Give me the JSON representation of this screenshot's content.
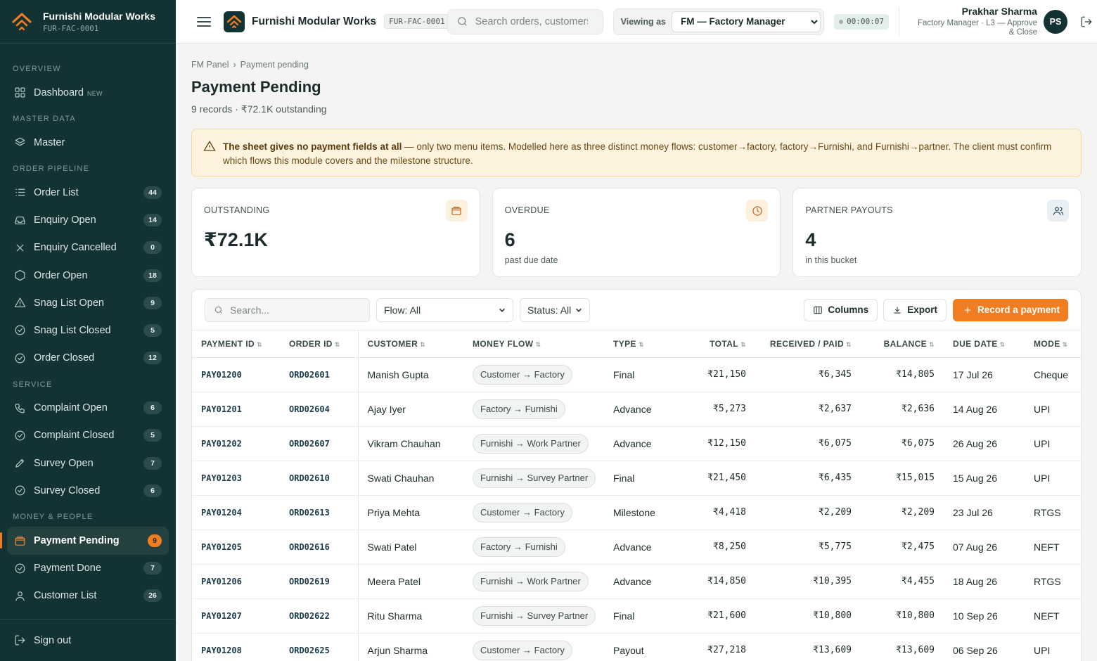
{
  "app": {
    "name": "Furnishi Modular Works",
    "code": "FUR-FAC-0001"
  },
  "sidebar": {
    "sections": [
      {
        "title": "OVERVIEW",
        "items": [
          {
            "label": "Dashboard",
            "tag": "NEW",
            "icon": "dashboard-icon"
          }
        ]
      },
      {
        "title": "MASTER DATA",
        "items": [
          {
            "label": "Master",
            "icon": "layers-icon"
          }
        ]
      },
      {
        "title": "ORDER PIPELINE",
        "items": [
          {
            "label": "Order List",
            "count": "44",
            "icon": "list-icon"
          },
          {
            "label": "Enquiry Open",
            "count": "14",
            "icon": "inbox-icon"
          },
          {
            "label": "Enquiry Cancelled",
            "count": "0",
            "icon": "x-icon"
          },
          {
            "label": "Order Open",
            "count": "18",
            "icon": "hexagon-icon"
          },
          {
            "label": "Snag List Open",
            "count": "9",
            "icon": "warning-icon"
          },
          {
            "label": "Snag List Closed",
            "count": "5",
            "icon": "check-circle-icon"
          },
          {
            "label": "Order Closed",
            "count": "12",
            "icon": "check-circle-icon"
          }
        ]
      },
      {
        "title": "SERVICE",
        "items": [
          {
            "label": "Complaint Open",
            "count": "6",
            "icon": "phone-icon"
          },
          {
            "label": "Complaint Closed",
            "count": "5",
            "icon": "check-circle-icon"
          },
          {
            "label": "Survey Open",
            "count": "7",
            "icon": "pencil-icon"
          },
          {
            "label": "Survey Closed",
            "count": "6",
            "icon": "check-circle-icon"
          }
        ]
      },
      {
        "title": "MONEY & PEOPLE",
        "items": [
          {
            "label": "Payment Pending",
            "count": "9",
            "icon": "wallet-icon",
            "active": true
          },
          {
            "label": "Payment Done",
            "count": "7",
            "icon": "check-circle-icon"
          },
          {
            "label": "Customer List",
            "count": "26",
            "icon": "user-icon"
          }
        ]
      }
    ],
    "signout_label": "Sign out"
  },
  "topbar": {
    "search_placeholder": "Search orders, customers",
    "viewing_label": "Viewing as",
    "viewing_selected": "FM — Factory Manager",
    "timer": "00:00:07",
    "user_name": "Prakhar Sharma",
    "user_role": "Factory Manager · L3 — Approve & Close",
    "avatar_initials": "PS"
  },
  "breadcrumb": {
    "root": "FM Panel",
    "current": "Payment pending"
  },
  "page": {
    "title": "Payment Pending",
    "subtitle": "9 records · ₹72.1K outstanding"
  },
  "alert": {
    "bold": "The sheet gives no payment fields at all",
    "text": " — only two menu items. Modelled here as three distinct money flows: customer→factory, factory→Furnishi, and Furnishi→partner. The client must confirm which flows this module covers and the milestone structure."
  },
  "stats": [
    {
      "label": "OUTSTANDING",
      "value": "₹72.1K",
      "sub": "",
      "icon": "wallet-icon",
      "icon_color": "#c2661a",
      "icon_bg": "#fdf0de"
    },
    {
      "label": "OVERDUE",
      "value": "6",
      "sub": "past due date",
      "icon": "clock-icon",
      "icon_color": "#c2661a",
      "icon_bg": "#fdf0de"
    },
    {
      "label": "PARTNER PAYOUTS",
      "value": "4",
      "sub": "in this bucket",
      "icon": "users-icon",
      "icon_color": "#2d4a57",
      "icon_bg": "#e9eff3"
    }
  ],
  "toolbar": {
    "search_placeholder": "Search...",
    "flow_filter": "Flow: All",
    "status_filter": "Status: All",
    "columns_label": "Columns",
    "export_label": "Export",
    "record_label": "Record a payment"
  },
  "table": {
    "columns": [
      "PAYMENT ID",
      "ORDER ID",
      "CUSTOMER",
      "MONEY FLOW",
      "TYPE",
      "TOTAL",
      "RECEIVED / PAID",
      "BALANCE",
      "DUE DATE",
      "MODE"
    ],
    "rows": [
      [
        "PAY01200",
        "ORD02601",
        "Manish Gupta",
        "Customer → Factory",
        "Final",
        "₹21,150",
        "₹6,345",
        "₹14,805",
        "17 Jul 26",
        "Cheque"
      ],
      [
        "PAY01201",
        "ORD02604",
        "Ajay Iyer",
        "Factory → Furnishi",
        "Advance",
        "₹5,273",
        "₹2,637",
        "₹2,636",
        "14 Aug 26",
        "UPI"
      ],
      [
        "PAY01202",
        "ORD02607",
        "Vikram Chauhan",
        "Furnishi → Work Partner",
        "Advance",
        "₹12,150",
        "₹6,075",
        "₹6,075",
        "26 Aug 26",
        "UPI"
      ],
      [
        "PAY01203",
        "ORD02610",
        "Swati Chauhan",
        "Furnishi → Survey Partner",
        "Final",
        "₹21,450",
        "₹6,435",
        "₹15,015",
        "15 Aug 26",
        "UPI"
      ],
      [
        "PAY01204",
        "ORD02613",
        "Priya Mehta",
        "Customer → Factory",
        "Milestone",
        "₹4,418",
        "₹2,209",
        "₹2,209",
        "23 Jul 26",
        "RTGS"
      ],
      [
        "PAY01205",
        "ORD02616",
        "Swati Patel",
        "Factory → Furnishi",
        "Advance",
        "₹8,250",
        "₹5,775",
        "₹2,475",
        "07 Aug 26",
        "NEFT"
      ],
      [
        "PAY01206",
        "ORD02619",
        "Meera Patel",
        "Furnishi → Work Partner",
        "Advance",
        "₹14,850",
        "₹10,395",
        "₹4,455",
        "18 Aug 26",
        "RTGS"
      ],
      [
        "PAY01207",
        "ORD02622",
        "Ritu Sharma",
        "Furnishi → Survey Partner",
        "Final",
        "₹21,600",
        "₹10,800",
        "₹10,800",
        "10 Sep 26",
        "NEFT"
      ],
      [
        "PAY01208",
        "ORD02625",
        "Arjun Sharma",
        "Customer → Factory",
        "Payout",
        "₹27,218",
        "₹13,609",
        "₹13,609",
        "06 Sep 26",
        "UPI"
      ]
    ]
  }
}
